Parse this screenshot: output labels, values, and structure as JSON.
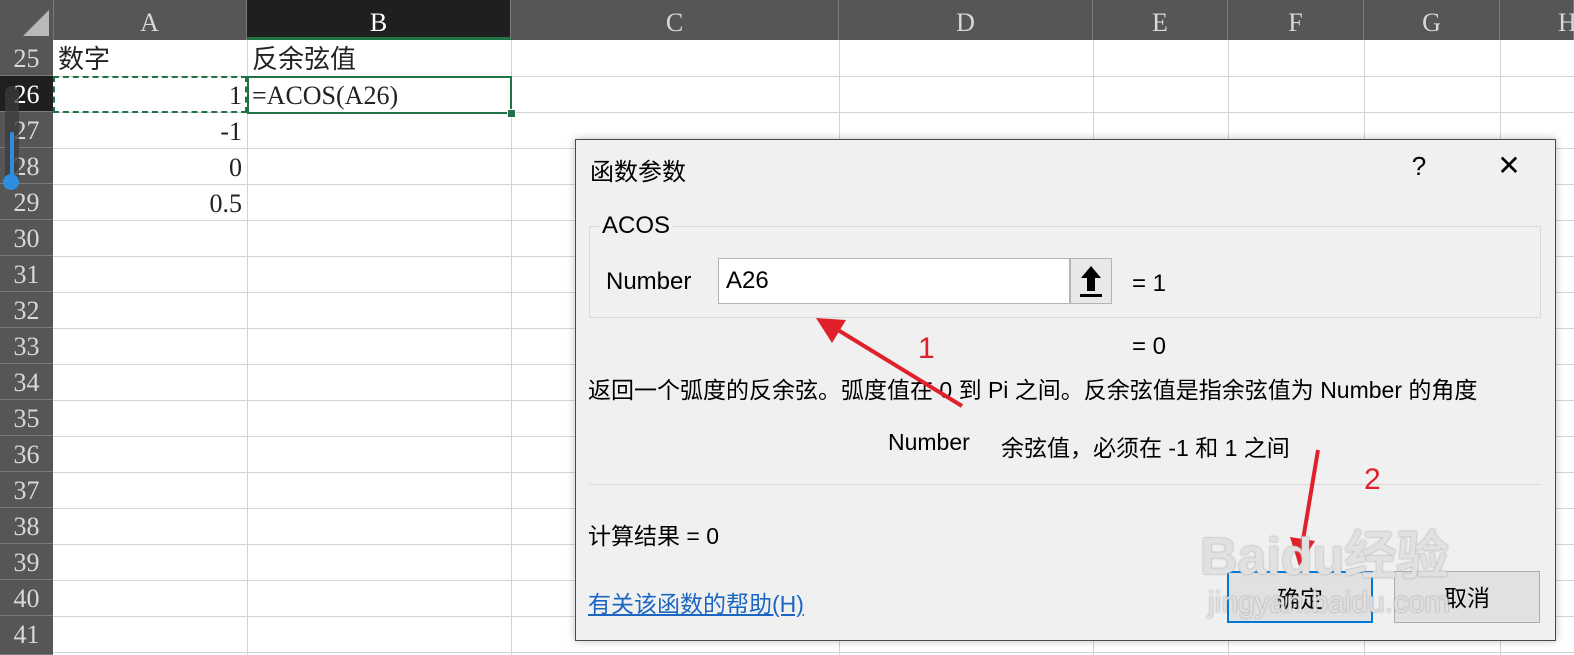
{
  "spreadsheet": {
    "columns": [
      "A",
      "B",
      "C",
      "D",
      "E",
      "F",
      "G",
      "H"
    ],
    "selected_column": "B",
    "rows": [
      "25",
      "26",
      "27",
      "28",
      "29",
      "30",
      "31",
      "32",
      "33",
      "34",
      "35",
      "36",
      "37",
      "38",
      "39",
      "40",
      "41"
    ],
    "selected_row": "26",
    "cells": {
      "a25": "数字",
      "b25": "反余弦值",
      "a26": "1",
      "b26": "=ACOS(A26)",
      "a27": "-1",
      "a28": "0",
      "a29": "0.5"
    }
  },
  "dialog": {
    "title": "函数参数",
    "help_glyph": "?",
    "close_glyph": "✕",
    "function_name": "ACOS",
    "argument_label": "Number",
    "argument_value": "A26",
    "argument_result": "=  1",
    "formula_result": "=  0",
    "description": "返回一个弧度的反余弦。弧度值在 0 到 Pi 之间。反余弦值是指余弦值为 Number 的角度",
    "argument_desc_name": "Number",
    "argument_desc_text": "余弦值，必须在 -1 和 1 之间",
    "calc_result_label": "计算结果 =   0",
    "help_link": "有关该函数的帮助(H)",
    "ok_label": "确定",
    "cancel_label": "取消"
  },
  "annotations": {
    "step1": "1",
    "step2": "2",
    "arrow_color": "#e0202a"
  },
  "watermark": {
    "brand": "Baidu经验",
    "url": "jingyan.baidu.com"
  },
  "colors": {
    "header_bg": "#565656",
    "selection_green": "#217346",
    "dialog_bg": "#f0f0f0",
    "link_blue": "#1a66c2",
    "ok_border": "#0078d7"
  }
}
